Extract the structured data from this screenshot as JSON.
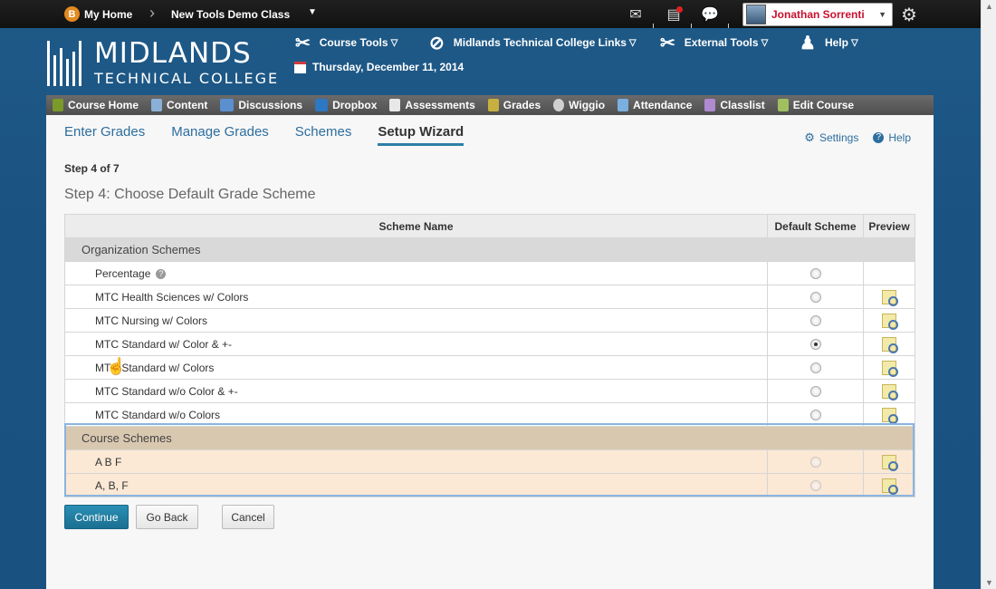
{
  "topbar": {
    "home_icon": "B",
    "home_label": "My Home",
    "class_label": "New Tools Demo Class",
    "user_name": "Jonathan Sorrenti",
    "icons": [
      "mail-icon",
      "alerts-icon",
      "chat-icon",
      "gear-icon"
    ]
  },
  "header": {
    "logo_line1": "MIDLANDS",
    "logo_line2": "TECHNICAL COLLEGE",
    "menus": [
      "Course Tools",
      "Midlands Technical College Links",
      "External Tools",
      "Help"
    ],
    "date": "Thursday, December 11, 2014"
  },
  "nav": {
    "items": [
      "Course Home",
      "Content",
      "Discussions",
      "Dropbox",
      "Assessments",
      "Grades",
      "Wiggio",
      "Attendance",
      "Classlist",
      "Edit Course"
    ],
    "colors": [
      "#7a9a2a",
      "#8ab0d8",
      "#5a8fd0",
      "#2e77c2",
      "#e8e8e8",
      "#c8b040",
      "#d0d0d0",
      "#7ab0e0",
      "#b08ad0",
      "#a0c060"
    ]
  },
  "tabs": [
    "Enter Grades",
    "Manage Grades",
    "Schemes",
    "Setup Wizard"
  ],
  "links": {
    "settings": "Settings",
    "help": "Help"
  },
  "step_small": "Step 4 of 7",
  "step_title": "Step 4: Choose Default Grade Scheme",
  "table": {
    "headers": [
      "Scheme Name",
      "Default Scheme",
      "Preview"
    ],
    "org_group": "Organization Schemes",
    "org_rows": [
      "Percentage",
      "MTC Health Sciences w/ Colors",
      "MTC Nursing w/ Colors",
      "MTC Standard w/ Color & +-",
      "MTC Standard w/ Colors",
      "MTC Standard w/o Color & +-",
      "MTC Standard w/o Colors"
    ],
    "selected": "MTC Standard w/ Color & +-",
    "course_group": "Course Schemes",
    "course_rows": [
      "A B F",
      "A, B, F"
    ]
  },
  "buttons": {
    "continue": "Continue",
    "back": "Go Back",
    "cancel": "Cancel"
  },
  "accent": "#2c7fa6"
}
